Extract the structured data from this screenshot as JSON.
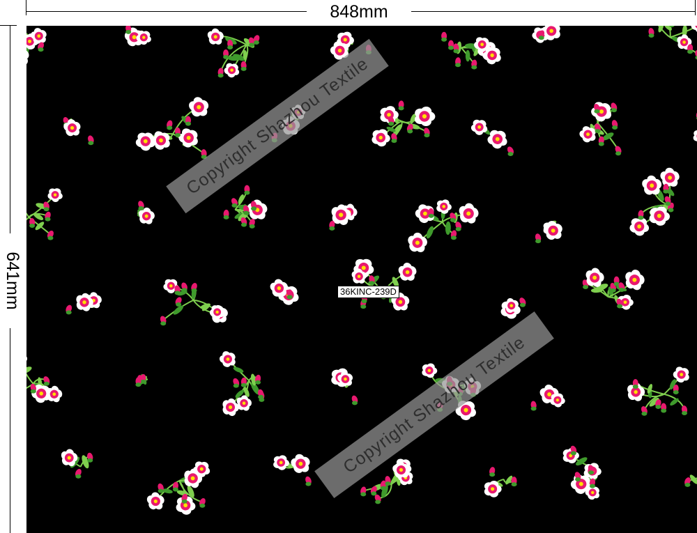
{
  "dimensions": {
    "width_label": "848mm",
    "height_label": "641mm"
  },
  "fabric": {
    "code": "36KINC-239D",
    "watermarks": [
      "Copyright Shazhou Textile",
      "Copyright Shazhou Textile"
    ],
    "colors": {
      "background": "#000000",
      "petal": "#ffffff",
      "petal_accent": "#e8196f",
      "center": "#ffe000",
      "leaf": "#3f9a2c",
      "leaf_light": "#7fcf4e"
    },
    "motif": "small pink-and-white wild rose sprigs with green leaves"
  }
}
